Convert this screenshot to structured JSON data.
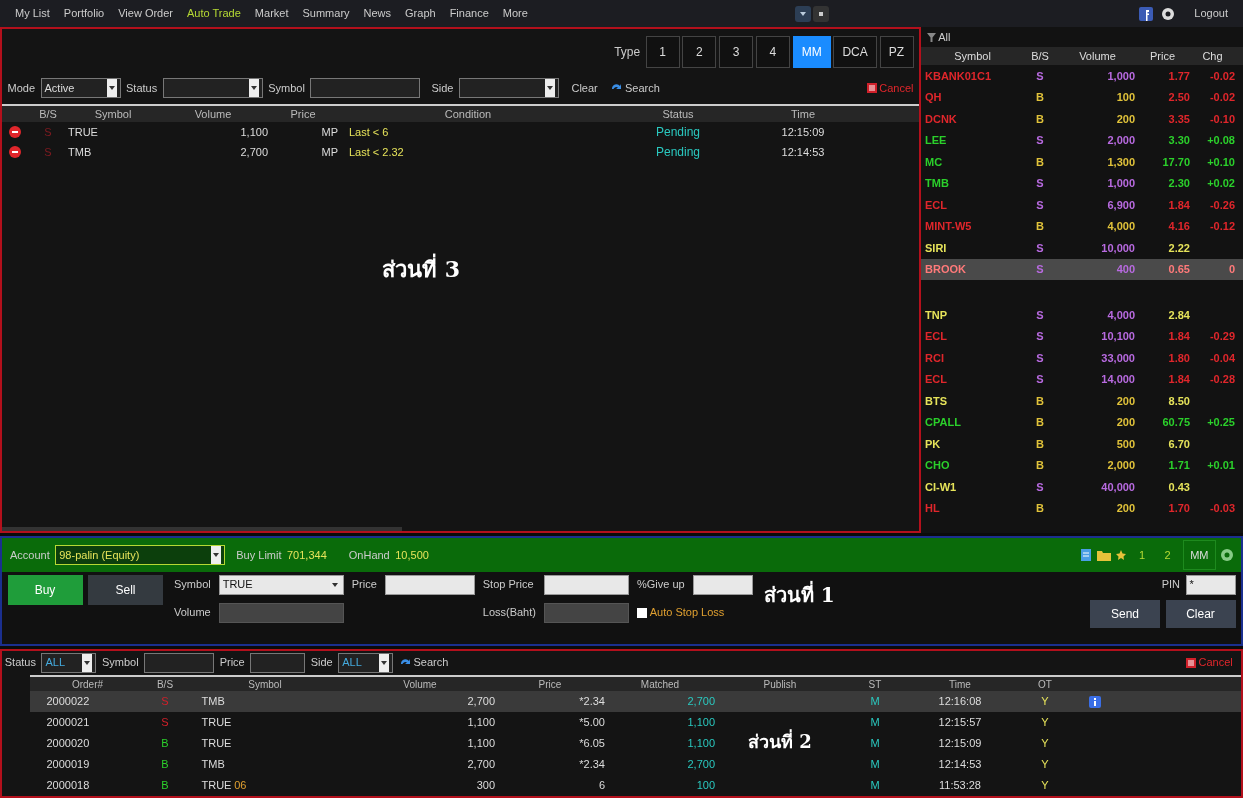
{
  "nav": {
    "items": [
      {
        "label": "My List",
        "selected": false
      },
      {
        "label": "Portfolio",
        "selected": false
      },
      {
        "label": "View Order",
        "selected": false
      },
      {
        "label": "Auto Trade",
        "selected": true
      },
      {
        "label": "Market",
        "selected": false
      },
      {
        "label": "Summary",
        "selected": false
      },
      {
        "label": "News",
        "selected": false
      },
      {
        "label": "Graph",
        "selected": false
      },
      {
        "label": "Finance",
        "selected": false
      },
      {
        "label": "More",
        "selected": false
      }
    ],
    "logout": "Logout"
  },
  "auto_trade": {
    "type_label": "Type",
    "types": [
      {
        "label": "1",
        "selected": false
      },
      {
        "label": "2",
        "selected": false
      },
      {
        "label": "3",
        "selected": false
      },
      {
        "label": "4",
        "selected": false
      },
      {
        "label": "MM",
        "selected": true
      },
      {
        "label": "DCA",
        "selected": false
      },
      {
        "label": "PZ",
        "selected": false
      }
    ],
    "mode_label": "Mode",
    "mode": "Active",
    "status_label": "Status",
    "symbol_label": "Symbol",
    "side_label": "Side",
    "clear": "Clear",
    "search": "Search",
    "cancel": "Cancel",
    "columns": [
      "B/S",
      "Symbol",
      "Volume",
      "Price",
      "Condition",
      "Status",
      "Time"
    ],
    "rows": [
      {
        "side": "S",
        "kind": "sell",
        "symbol": "TRUE",
        "volume": "1,100",
        "price": "MP",
        "condition": "Last < 6",
        "status": "Pending",
        "time": "12:15:09"
      },
      {
        "side": "S",
        "kind": "sell",
        "symbol": "TMB",
        "volume": "2,700",
        "price": "MP",
        "condition": "Last < 2.32",
        "status": "Pending",
        "time": "12:14:53"
      }
    ],
    "section_label": "ส่วนที่ 3"
  },
  "ticker": {
    "filter": "All",
    "columns": [
      "Symbol",
      "B/S",
      "Volume",
      "Price",
      "Chg"
    ],
    "groups": [
      [
        {
          "symbol": "KBANK01C1",
          "side": "S",
          "kind": "sell",
          "volume": "1,000",
          "price": "1.77",
          "change": "-0.02",
          "color": "#e0262b",
          "selected": false
        },
        {
          "symbol": "QH",
          "side": "B",
          "kind": "buy",
          "volume": "100",
          "price": "2.50",
          "change": "-0.02",
          "color": "#e0262b",
          "selected": false
        },
        {
          "symbol": "DCNK",
          "side": "B",
          "kind": "buy",
          "volume": "200",
          "price": "3.35",
          "change": "-0.10",
          "color": "#e0262b",
          "selected": false
        },
        {
          "symbol": "LEE",
          "side": "S",
          "kind": "sell",
          "volume": "2,000",
          "price": "3.30",
          "change": "+0.08",
          "color": "#2bd02b",
          "selected": false
        },
        {
          "symbol": "MC",
          "side": "B",
          "kind": "buy",
          "volume": "1,300",
          "price": "17.70",
          "change": "+0.10",
          "color": "#2bd02b",
          "selected": false
        },
        {
          "symbol": "TMB",
          "side": "S",
          "kind": "sell",
          "volume": "1,000",
          "price": "2.30",
          "change": "+0.02",
          "color": "#2bd02b",
          "selected": false
        },
        {
          "symbol": "ECL",
          "side": "S",
          "kind": "sell",
          "volume": "6,900",
          "price": "1.84",
          "change": "-0.26",
          "color": "#e0262b",
          "selected": false
        },
        {
          "symbol": "MINT-W5",
          "side": "B",
          "kind": "buy",
          "volume": "4,000",
          "price": "4.16",
          "change": "-0.12",
          "color": "#e0262b",
          "selected": false
        },
        {
          "symbol": "SIRI",
          "side": "S",
          "kind": "sell",
          "volume": "10,000",
          "price": "2.22",
          "color": "#e6e35a",
          "selected": false
        },
        {
          "symbol": "BROOK",
          "side": "S",
          "kind": "sell",
          "volume": "400",
          "price": "0.65",
          "change": "0",
          "color": "#ff7a7a",
          "selected": true
        }
      ],
      [
        {
          "symbol": "TNP",
          "side": "S",
          "kind": "sell",
          "volume": "4,000",
          "price": "2.84",
          "color": "#e6e35a",
          "selected": false
        },
        {
          "symbol": "ECL",
          "side": "S",
          "kind": "sell",
          "volume": "10,100",
          "price": "1.84",
          "change": "-0.29",
          "color": "#e0262b",
          "selected": false
        },
        {
          "symbol": "RCI",
          "side": "S",
          "kind": "sell",
          "volume": "33,000",
          "price": "1.80",
          "change": "-0.04",
          "color": "#e0262b",
          "selected": false
        },
        {
          "symbol": "ECL",
          "side": "S",
          "kind": "sell",
          "volume": "14,000",
          "price": "1.84",
          "change": "-0.28",
          "color": "#e0262b",
          "selected": false
        },
        {
          "symbol": "BTS",
          "side": "B",
          "kind": "buy",
          "volume": "200",
          "price": "8.50",
          "color": "#e6e35a",
          "selected": false
        },
        {
          "symbol": "CPALL",
          "side": "B",
          "kind": "buy",
          "volume": "200",
          "price": "60.75",
          "change": "+0.25",
          "color": "#2bd02b",
          "selected": false
        },
        {
          "symbol": "PK",
          "side": "B",
          "kind": "buy",
          "volume": "500",
          "price": "6.70",
          "color": "#e6e35a",
          "selected": false
        },
        {
          "symbol": "CHO",
          "side": "B",
          "kind": "buy",
          "volume": "2,000",
          "price": "1.71",
          "change": "+0.01",
          "color": "#2bd02b",
          "selected": false
        },
        {
          "symbol": "CI-W1",
          "side": "S",
          "kind": "sell",
          "volume": "40,000",
          "price": "0.43",
          "color": "#e6e35a",
          "selected": false
        },
        {
          "symbol": "HL",
          "side": "B",
          "kind": "buy",
          "volume": "200",
          "price": "1.70",
          "change": "-0.03",
          "color": "#e0262b",
          "selected": false
        }
      ]
    ]
  },
  "order_entry": {
    "account_label": "Account",
    "account": "98-palin (Equity)",
    "buy_limit_label": "Buy Limit",
    "buy_limit": "701,344",
    "onhand_label": "OnHand",
    "onhand": "10,500",
    "pages": [
      {
        "label": "1",
        "selected": false
      },
      {
        "label": "2",
        "selected": false
      }
    ],
    "mode": "MM",
    "actions": [
      {
        "label": "Buy",
        "selected": true
      },
      {
        "label": "Sell",
        "selected": false
      }
    ],
    "symbol_label": "Symbol",
    "symbol": "TRUE",
    "price_label": "Price",
    "stop_price_label": "Stop Price",
    "giveup_label": "%Give up",
    "volume_label": "Volume",
    "loss_label": "Loss(Baht)",
    "auto_stop_loss": {
      "label": "Auto Stop Loss",
      "checked": false
    },
    "pin_label": "PIN",
    "pin": "*",
    "send": "Send",
    "clear": "Clear",
    "section_label": "ส่วนที่ 1"
  },
  "orders": {
    "status_label": "Status",
    "status": "ALL",
    "symbol_label": "Symbol",
    "price_label": "Price",
    "side_label": "Side",
    "side": "ALL",
    "search": "Search",
    "cancel": "Cancel",
    "columns": [
      "Order#",
      "B/S",
      "Symbol",
      "Volume",
      "Price",
      "Matched",
      "Publish",
      "ST",
      "Time",
      "OT"
    ],
    "rows": [
      {
        "order": "2000022",
        "side": "S",
        "kind": "sell",
        "symbol": "TMB",
        "volume": "2,700",
        "price": "*2.34",
        "matched": "2,700",
        "st": "M",
        "time": "12:16:08",
        "ot": "Y",
        "selected": true
      },
      {
        "order": "2000021",
        "side": "S",
        "kind": "sell",
        "symbol": "TRUE",
        "volume": "1,100",
        "price": "*5.00",
        "matched": "1,100",
        "st": "M",
        "time": "12:15:57",
        "ot": "Y",
        "selected": false
      },
      {
        "order": "2000020",
        "side": "B",
        "kind": "buy",
        "symbol": "TRUE",
        "volume": "1,100",
        "price": "*6.05",
        "matched": "1,100",
        "st": "M",
        "time": "12:15:09",
        "ot": "Y",
        "selected": false
      },
      {
        "order": "2000019",
        "side": "B",
        "kind": "buy",
        "symbol": "TMB",
        "volume": "2,700",
        "price": "*2.34",
        "matched": "2,700",
        "st": "M",
        "time": "12:14:53",
        "ot": "Y",
        "selected": false
      },
      {
        "order": "2000018",
        "side": "B",
        "kind": "buy",
        "symbol": "TRUE",
        "tag": "06",
        "volume": "300",
        "price": "6",
        "matched": "100",
        "st": "M",
        "time": "11:53:28",
        "ot": "Y",
        "selected": false
      }
    ],
    "section_label": "ส่วนที่ 2"
  }
}
